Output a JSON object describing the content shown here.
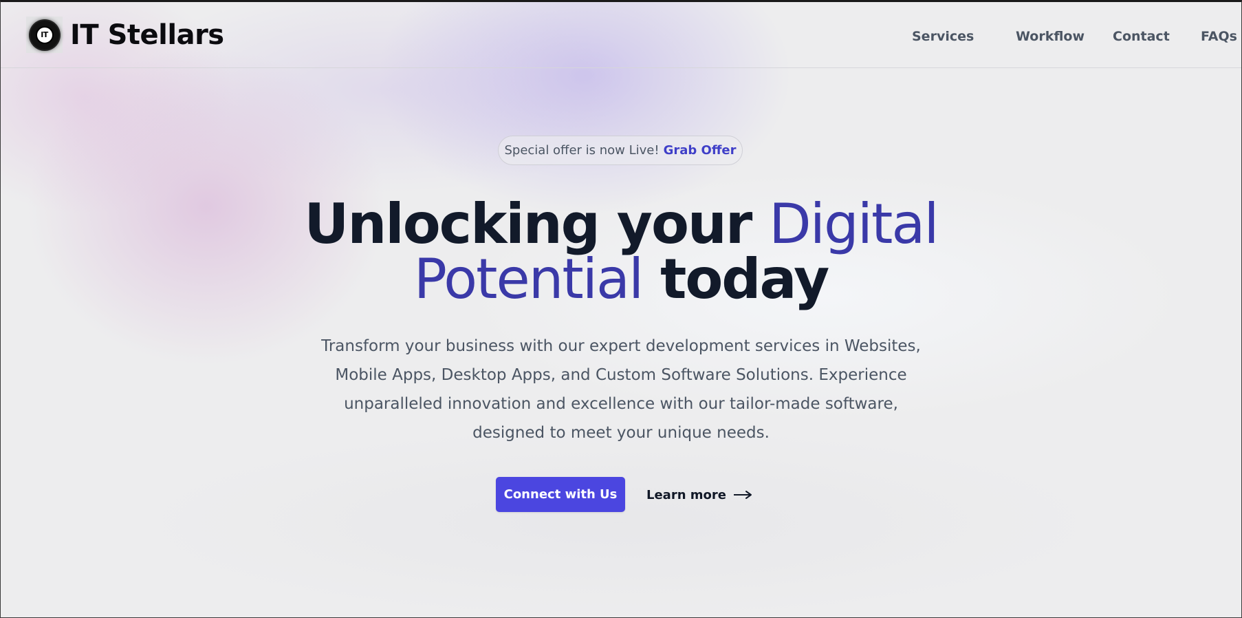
{
  "header": {
    "logo_text": "IT",
    "brand": "IT Stellars",
    "nav": [
      {
        "label": "Services"
      },
      {
        "label": "Workflow"
      },
      {
        "label": "Contact"
      },
      {
        "label": "FAQs"
      }
    ]
  },
  "hero": {
    "offer": {
      "text": "Special offer is now Live!",
      "link": "Grab Offer"
    },
    "headline": {
      "part1": "Unlocking your ",
      "accent1": "Digital",
      "accent2": "Potential",
      "part2": " today"
    },
    "subtitle": "Transform your business with our expert development services in Websites, Mobile Apps, Desktop Apps, and Custom Software Solutions. Experience unparalleled innovation and excellence with our tailor-made software, designed to meet your unique needs.",
    "primary_button": "Connect with Us",
    "secondary_link": "Learn more",
    "secondary_icon": "arrow-right-icon"
  },
  "colors": {
    "accent": "#3a39a8",
    "button": "#4b46e0",
    "heading": "#121a2a",
    "body_text": "#4b5563"
  }
}
